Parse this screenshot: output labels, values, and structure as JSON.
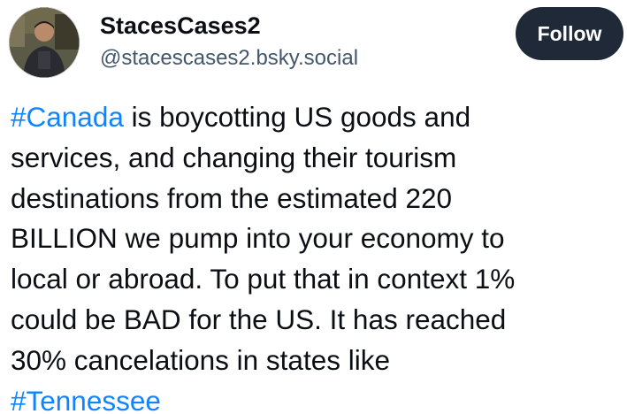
{
  "post": {
    "display_name": "StacesCases2",
    "handle": "@stacescases2.bsky.social",
    "follow_label": "Follow",
    "avatar_icon": "profile-photo-icon",
    "colors": {
      "text": "#0b0f14",
      "handle": "#42576c",
      "hashtag": "#1083fe",
      "follow_bg": "#1f2937",
      "follow_text": "#ffffff"
    },
    "lines": [
      {
        "tag": "#Canada",
        "rest": " is boycotting US goods and"
      },
      {
        "text": "services, and changing their tourism"
      },
      {
        "text": "destinations from the estimated 220"
      },
      {
        "text": "BILLION we pump into your economy to"
      },
      {
        "text": "local or abroad. To put that in context 1%"
      },
      {
        "text": "could be BAD for the US. It has reached"
      },
      {
        "text": "30% cancelations in states like"
      },
      {
        "tag": "#Tennessee"
      }
    ]
  }
}
